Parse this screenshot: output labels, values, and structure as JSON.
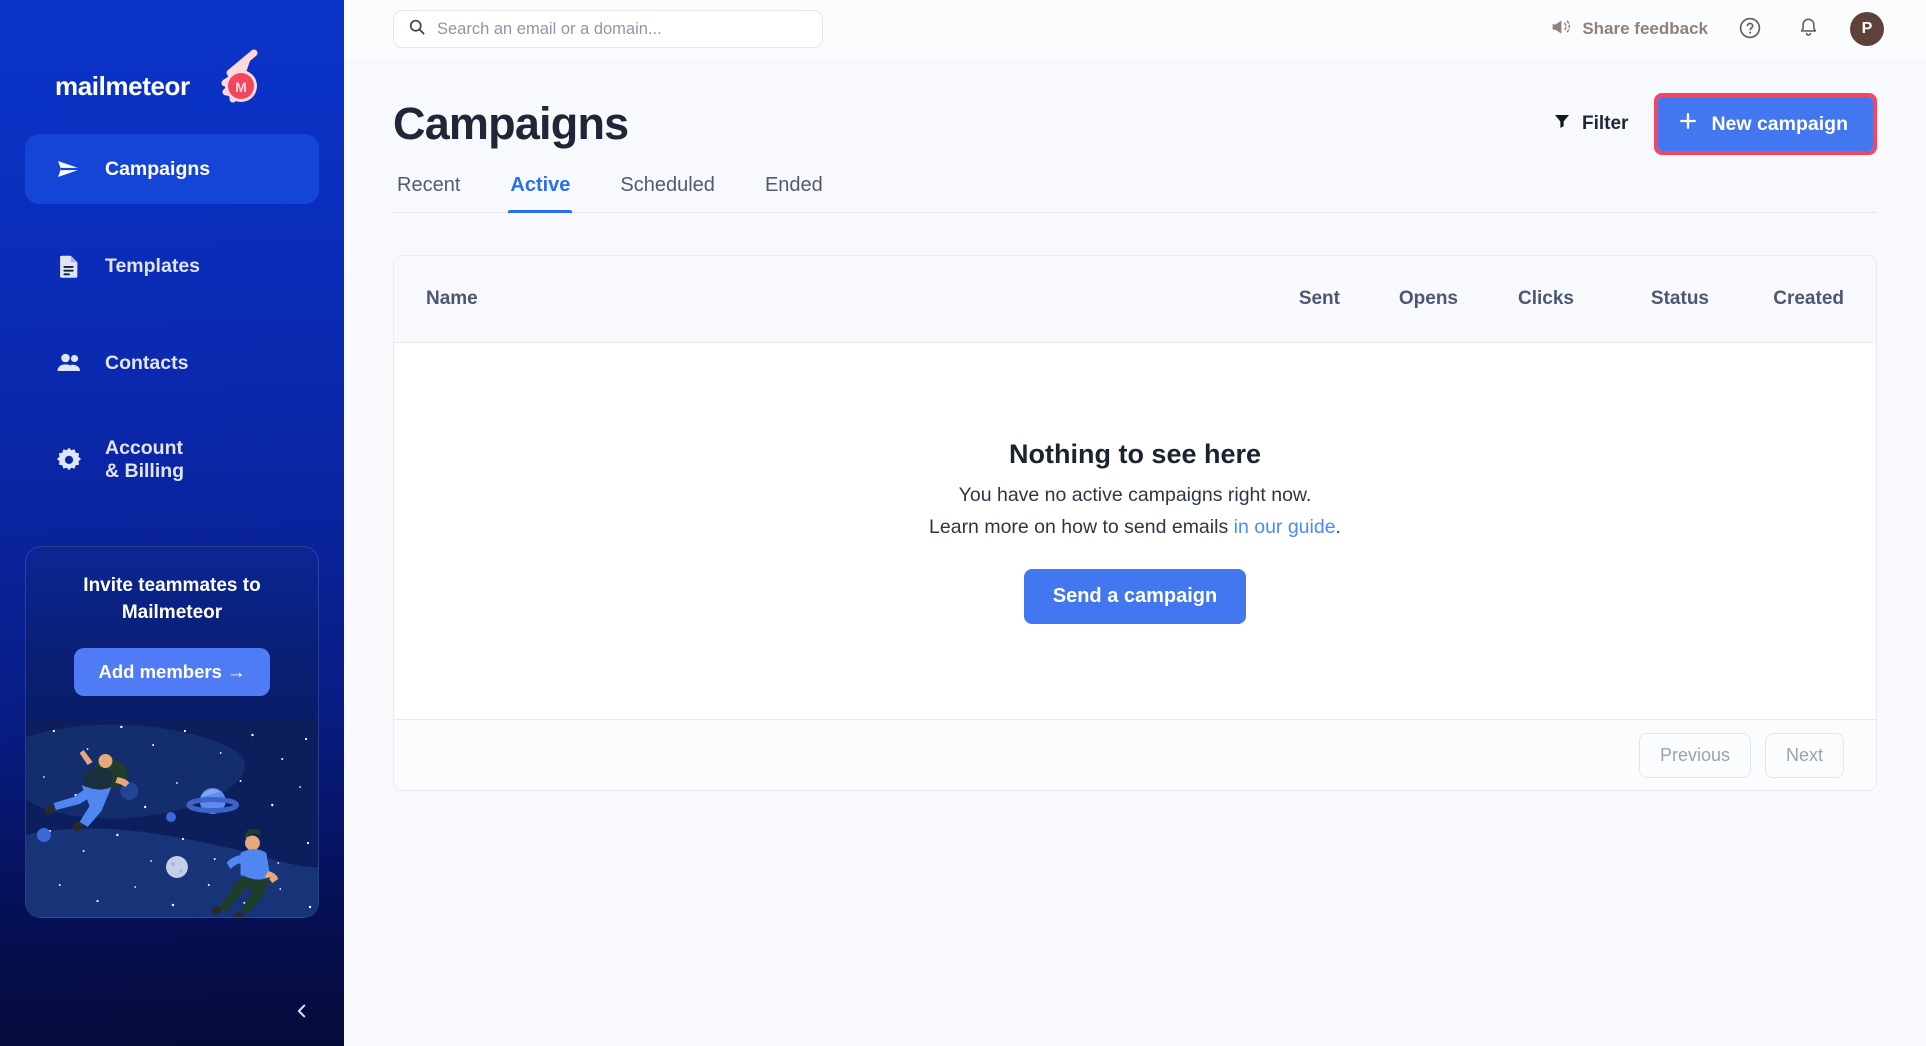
{
  "sidebar": {
    "logo_text": "mailmeteor",
    "logo_icon": "meteor-logo-icon",
    "items": [
      {
        "label": "Campaigns",
        "icon": "paper-plane-icon",
        "active": true
      },
      {
        "label": "Templates",
        "icon": "document-icon",
        "active": false
      },
      {
        "label": "Contacts",
        "icon": "people-icon",
        "active": false
      },
      {
        "label": "Account\n& Billing",
        "icon": "gear-icon",
        "active": false
      }
    ],
    "invite": {
      "title": "Invite teammates to Mailmeteor",
      "button_label": "Add members →",
      "illustration": "space-floating-people-illustration"
    },
    "collapse_icon": "chevron-left-icon",
    "colors": {
      "top": "#0b35c9",
      "bottom": "#050b38",
      "active_item": "#1545d6"
    }
  },
  "topbar": {
    "search": {
      "placeholder": "Search an email or a domain...",
      "value": "",
      "icon": "search-icon"
    },
    "feedback_label": "Share feedback",
    "feedback_icon": "megaphone-icon",
    "help_icon": "question-circle-icon",
    "notifications_icon": "bell-icon",
    "avatar_initial": "P",
    "avatar_color": "#5d423a"
  },
  "page": {
    "title": "Campaigns",
    "filter_label": "Filter",
    "filter_icon": "funnel-icon",
    "new_campaign_label": "New campaign",
    "new_campaign_icon": "plus-icon",
    "new_campaign_highlight_color": "#f5455f",
    "accent_color": "#4277f0"
  },
  "tabs": [
    {
      "label": "Recent",
      "active": false
    },
    {
      "label": "Active",
      "active": true
    },
    {
      "label": "Scheduled",
      "active": false
    },
    {
      "label": "Ended",
      "active": false
    }
  ],
  "table": {
    "columns": [
      "Name",
      "Sent",
      "Opens",
      "Clicks",
      "Status",
      "Created"
    ],
    "rows": [],
    "empty_state": {
      "title": "Nothing to see here",
      "line1": "You have no active campaigns right now.",
      "line2_prefix": "Learn more on how to send emails ",
      "line2_link": "in our guide",
      "line2_suffix": ".",
      "cta_label": "Send a campaign"
    },
    "pagination": {
      "previous_label": "Previous",
      "next_label": "Next"
    }
  }
}
